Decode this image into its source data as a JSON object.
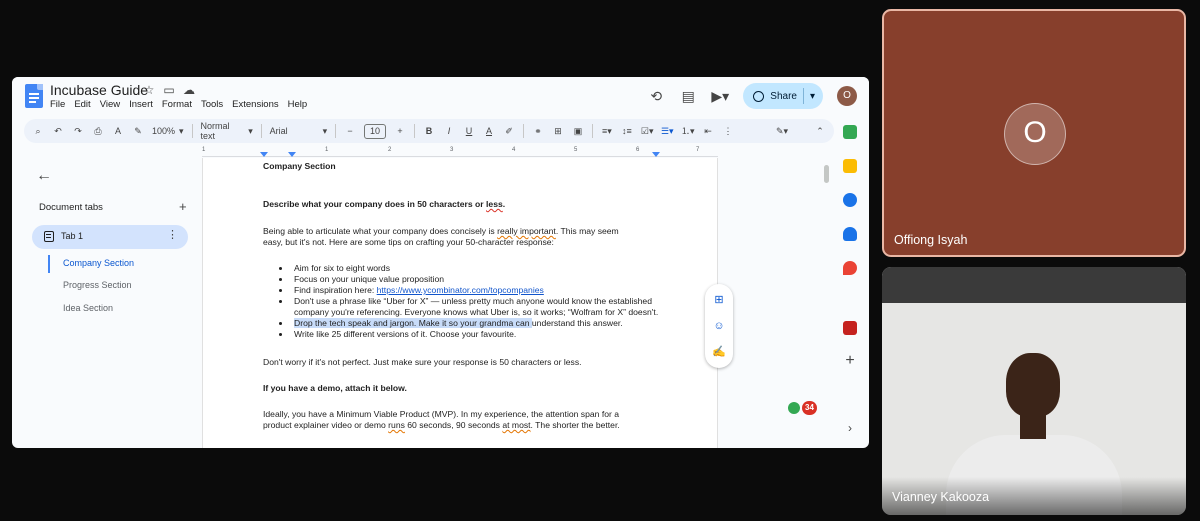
{
  "doc": {
    "title": "Incubase Guide",
    "menu": [
      "File",
      "Edit",
      "View",
      "Insert",
      "Format",
      "Tools",
      "Extensions",
      "Help"
    ],
    "share_label": "Share",
    "account_initial": "O",
    "toolbar": {
      "zoom": "100%",
      "style": "Normal text",
      "font": "Arial",
      "font_size": "10"
    },
    "ruler_marks": [
      "1",
      "1",
      "2",
      "3",
      "4",
      "5",
      "6",
      "7"
    ],
    "sidebar": {
      "heading": "Document tabs",
      "tab_label": "Tab 1",
      "outline": [
        "Company Section",
        "Progress Section",
        "Idea Section"
      ]
    },
    "content": {
      "section_title": "Company Section",
      "q1": "Describe what your company does in 50 characters or ",
      "q1_less": "less",
      "q1_end": ".",
      "p1_a": "Being able to articulate what your company does concisely is ",
      "p1_b": "really important",
      "p1_c": ". This may seem",
      "p1_line2": "easy, but it's not. Here are some tips on crafting your 50-character response:",
      "bullets": [
        "Aim for six to eight words",
        "Focus on your unique value proposition",
        "Find inspiration here: ",
        "Don't use a phrase like “Uber for X” — unless pretty much anyone would know the established",
        "company you're referencing. Everyone knows what Uber is, so it works; “Wolfram for X” doesn't.",
        "Drop the tech speak and jargon. Make it so your grandma can ",
        "understand this answer.",
        "Write like 25 different versions of it. Choose your favourite."
      ],
      "link": "https://www.ycombinator.com/topcompanies",
      "p2": "Don't worry if it's not perfect. Just make sure your response is 50 characters or less.",
      "q2": "If you have a demo, attach it below.",
      "p3_line1": "Ideally, you have a Minimum Viable Product (MVP). In my experience, the attention span for a",
      "p3_a": "product explainer video or demo ",
      "p3_runs": "runs",
      "p3_b": " 60 seconds, 90 seconds ",
      "p3_atmost": "at most",
      "p3_c": ". The shorter the better."
    },
    "badge_count": "34"
  },
  "participants": [
    {
      "name": "Offiong Isyah",
      "initial": "O"
    },
    {
      "name": "Vianney Kakooza"
    }
  ],
  "colors": {
    "share_bg": "#c2e7ff",
    "tab_active": "#d3e3fd",
    "tile_orange": "#873f2c",
    "link": "#1155cc"
  }
}
